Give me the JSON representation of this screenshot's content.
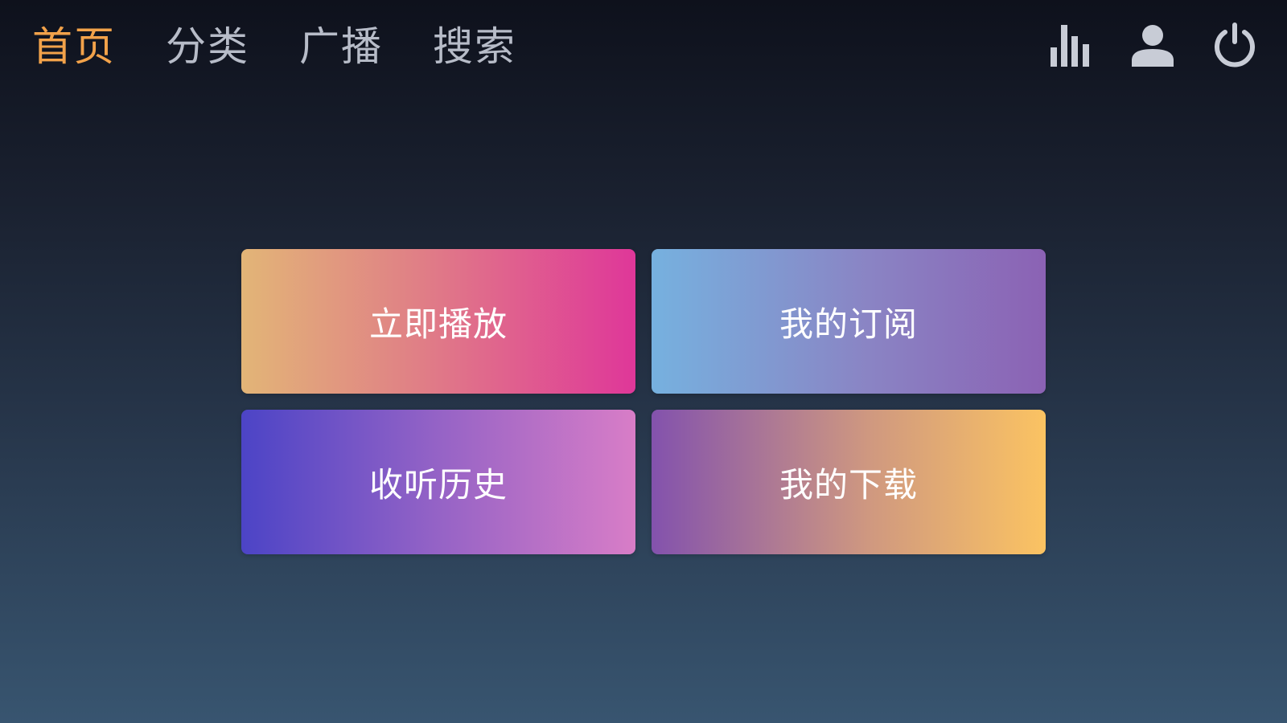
{
  "nav": {
    "tabs": [
      {
        "label": "首页",
        "active": true
      },
      {
        "label": "分类",
        "active": false
      },
      {
        "label": "广播",
        "active": false
      },
      {
        "label": "搜索",
        "active": false
      }
    ],
    "icons": [
      "equalizer-icon",
      "user-icon",
      "power-icon"
    ]
  },
  "cards": [
    {
      "label": "立即播放"
    },
    {
      "label": "我的订阅"
    },
    {
      "label": "收听历史"
    },
    {
      "label": "我的下载"
    }
  ],
  "colors": {
    "active_tab": "#f2a24a",
    "inactive_tab": "#b7bcc8",
    "icon": "#c8ccd6"
  }
}
